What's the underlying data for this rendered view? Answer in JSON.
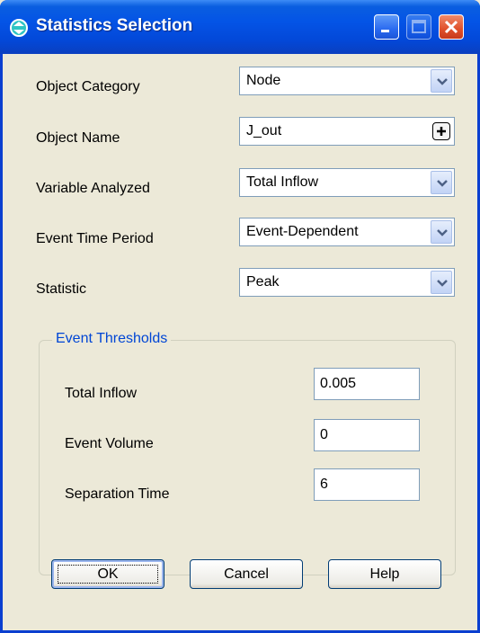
{
  "window": {
    "title": "Statistics Selection"
  },
  "fields": [
    {
      "label": "Object Category",
      "value": "Node"
    },
    {
      "label": "Object Name",
      "value": "J_out"
    },
    {
      "label": "Variable Analyzed",
      "value": "Total Inflow"
    },
    {
      "label": "Event Time Period",
      "value": "Event-Dependent"
    },
    {
      "label": "Statistic",
      "value": "Peak"
    }
  ],
  "thresholds": {
    "title": "Event Thresholds",
    "items": [
      {
        "label": "Total Inflow",
        "value": "0.005"
      },
      {
        "label": "Event Volume",
        "value": "0"
      },
      {
        "label": "Separation Time",
        "value": "6"
      }
    ]
  },
  "buttons": {
    "ok": "OK",
    "cancel": "Cancel",
    "help": "Help"
  },
  "colors": {
    "titlebar": "#0454e6",
    "face": "#ece9d8",
    "group_title": "#0046d5"
  },
  "icons": {
    "app": "globe-arrows-icon",
    "dropdown": "chevron-down-icon",
    "browse": "plus-icon"
  }
}
